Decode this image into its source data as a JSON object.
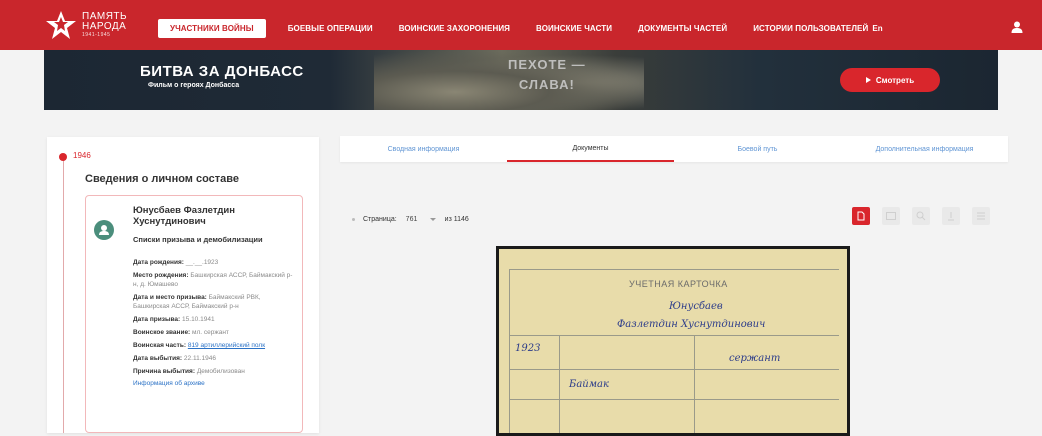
{
  "logo": {
    "line1": "ПАМЯТЬ",
    "line2": "НАРОДА",
    "line3": "1941-1945"
  },
  "nav": {
    "items": [
      {
        "label": "Участники войны",
        "active": true
      },
      {
        "label": "Боевые операции",
        "active": false
      },
      {
        "label": "Воинские захоронения",
        "active": false
      },
      {
        "label": "Воинские части",
        "active": false
      },
      {
        "label": "Документы частей",
        "active": false
      },
      {
        "label": "Истории пользователей",
        "active": false
      }
    ],
    "lang": "En"
  },
  "banner": {
    "title": "БИТВА ЗА ДОНБАСС",
    "subtitle": "Фильм о героях Донбасса",
    "slogan_line1": "ПЕХОТЕ —",
    "slogan_line2": "СЛАВА!",
    "watch_label": "Смотреть"
  },
  "timeline": {
    "year": "1946"
  },
  "personnel": {
    "section_title": "Сведения о личном составе",
    "name": "Юнусбаев Фазлетдин Хуснутдинович",
    "record_type": "Списки призыва и демобилизации",
    "fields": [
      {
        "label": "Дата рождения:",
        "value": "__.__.1923"
      },
      {
        "label": "Место рождения:",
        "value": "Башкирская АССР, Баймакский р-н, д. Юмашево"
      },
      {
        "label": "Дата и место призыва:",
        "value": "Баймакский РВК, Башкирская АССР, Баймакский р-н"
      },
      {
        "label": "Дата призыва:",
        "value": "15.10.1941"
      },
      {
        "label": "Воинское звание:",
        "value": "мл. сержант"
      },
      {
        "label": "Воинская часть:",
        "value": "819 артиллерийский полк",
        "link": true
      },
      {
        "label": "Дата выбытия:",
        "value": "22.11.1946"
      },
      {
        "label": "Причина выбытия:",
        "value": "Демобилизован"
      }
    ],
    "info_link": "Информация об архиве"
  },
  "tabs": [
    {
      "label": "Сводная информация",
      "active": false
    },
    {
      "label": "Документы",
      "active": true
    },
    {
      "label": "Боевой путь",
      "active": false
    },
    {
      "label": "Дополнительная информация",
      "active": false
    }
  ],
  "pager": {
    "label": "Страница:",
    "current": "761",
    "total_label": "из 1146"
  },
  "tools": [
    {
      "icon": "document-icon",
      "active": true
    },
    {
      "icon": "image-icon",
      "active": false
    },
    {
      "icon": "zoom-icon",
      "active": false
    },
    {
      "icon": "download-icon",
      "active": false
    },
    {
      "icon": "menu-icon",
      "active": false
    }
  ],
  "document": {
    "heading": "УЧЕТНАЯ КАРТОЧКА",
    "hand1": "Юнусбаев",
    "hand2": "Фазлетдин Хуснутдинович",
    "hand3": "1923",
    "hand4": "Баймак",
    "hand5": "сержант"
  },
  "colors": {
    "brand_red": "#c9262c",
    "accent_red": "#d9262c",
    "link_blue": "#2b72c6"
  }
}
